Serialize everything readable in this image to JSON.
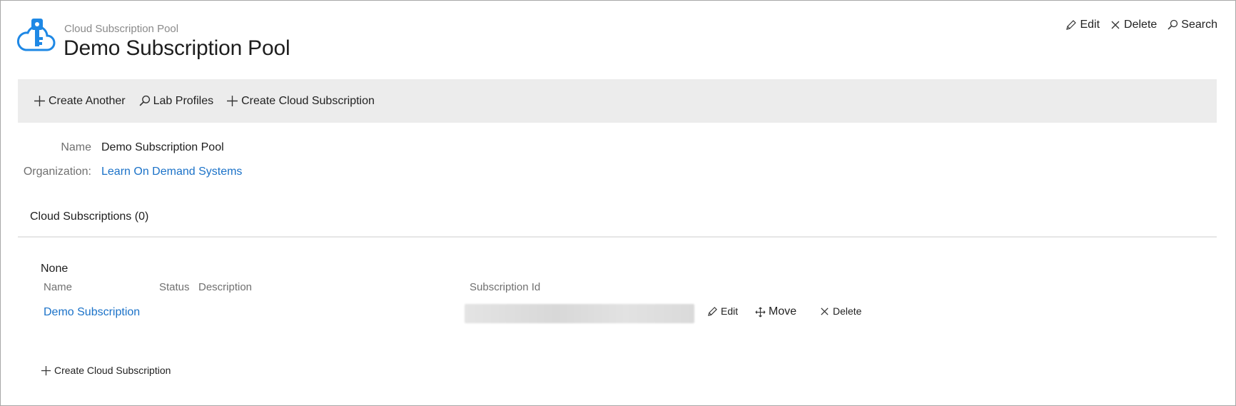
{
  "header": {
    "breadcrumb": "Cloud Subscription Pool",
    "title": "Demo Subscription Pool",
    "logo_icon": "cloud-key-icon",
    "actions": [
      {
        "label": "Edit",
        "icon": "pencil-icon"
      },
      {
        "label": "Delete",
        "icon": "close-icon"
      },
      {
        "label": "Search",
        "icon": "search-icon"
      }
    ]
  },
  "toolbar": {
    "create_another": "Create Another",
    "lab_profiles": "Lab Profiles",
    "create_cloud_subscription": "Create Cloud Subscription"
  },
  "details": {
    "name_label": "Name",
    "name_value": "Demo Subscription Pool",
    "org_label": "Organization:",
    "org_value": "Learn On Demand Systems"
  },
  "subscriptions": {
    "section_title": "Cloud Subscriptions (0)",
    "none_text": "None",
    "columns": [
      "Name",
      "Status",
      "Description",
      "Subscription Id"
    ],
    "rows": [
      {
        "name": "Demo Subscription",
        "status": "",
        "description": "",
        "subscription_id_obscured": true,
        "actions": {
          "edit": "Edit",
          "move": "Move",
          "delete": "Delete"
        }
      }
    ],
    "create_label": "Create Cloud Subscription"
  },
  "colors": {
    "link": "#1b72c8",
    "toolbar_bg": "#ececec",
    "logo": "#1e88e5"
  }
}
